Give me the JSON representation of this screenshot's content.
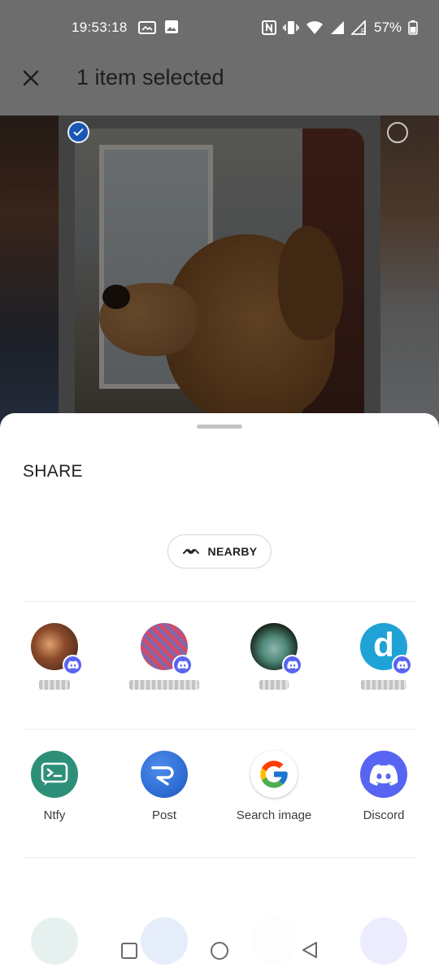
{
  "status_bar": {
    "time": "19:53:18",
    "battery_percent": "57%",
    "icons": [
      "screenshot-icon",
      "image-icon",
      "nfc-icon",
      "vibrate-icon",
      "wifi-icon",
      "signal-icon",
      "signal-roaming-icon",
      "battery-icon"
    ]
  },
  "app_bar": {
    "title": "1 item selected",
    "close_icon": "close-icon"
  },
  "share_sheet": {
    "title": "SHARE",
    "nearby_label": "NEARBY",
    "nearby_icon": "nearby-share-icon",
    "contacts": [
      {
        "avatar_color": "#6b3a2a",
        "badge": "discord-icon"
      },
      {
        "avatar_color": "#c8466a",
        "badge": "discord-icon"
      },
      {
        "avatar_color": "#1f2a22",
        "badge": "discord-icon"
      },
      {
        "avatar_color": "#1fa3d6",
        "avatar_letter": "d",
        "badge": "discord-icon"
      }
    ],
    "apps": [
      {
        "label": "Ntfy",
        "icon": "ntfy-icon",
        "color": "#2e8f78"
      },
      {
        "label": "Post",
        "icon": "post-icon",
        "color": "#2f6fd6"
      },
      {
        "label": "Search image",
        "icon": "google-icon",
        "color": "#ffffff"
      },
      {
        "label": "Discord",
        "icon": "discord-icon",
        "color": "#5865f2"
      }
    ]
  },
  "colors": {
    "selection_blue": "#1a56b4",
    "discord": "#5865f2"
  }
}
